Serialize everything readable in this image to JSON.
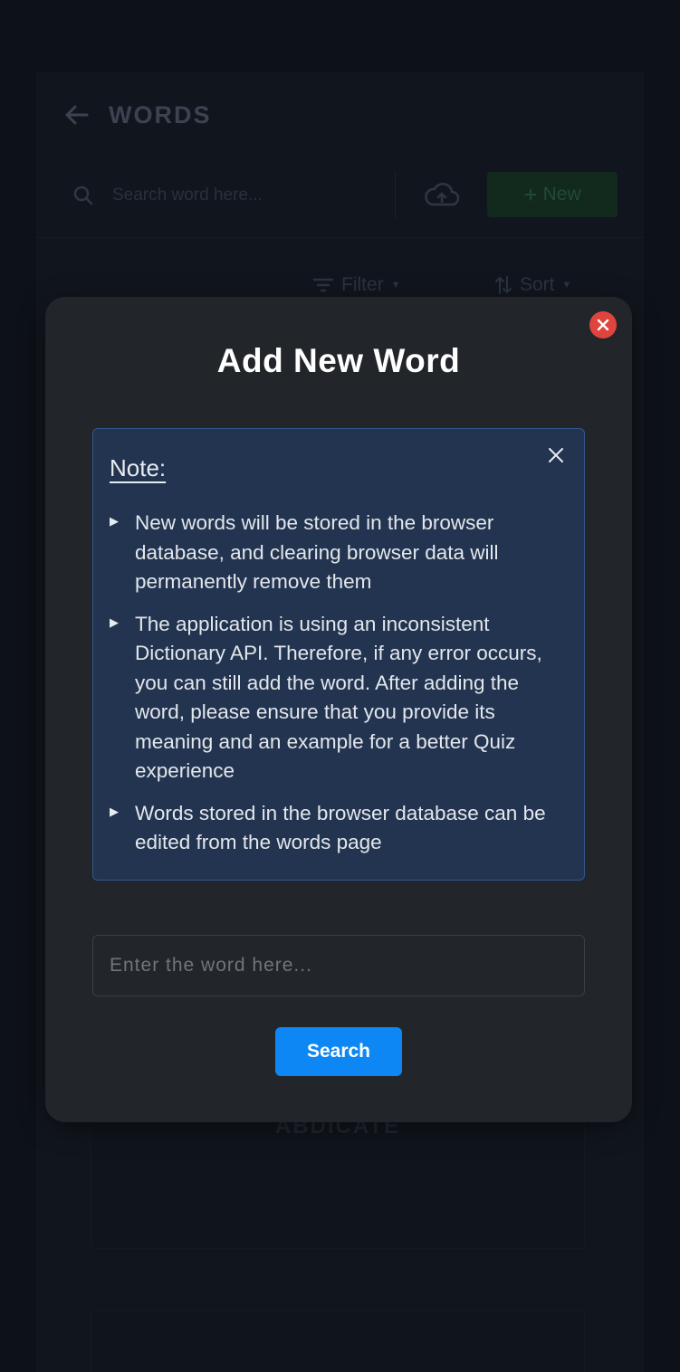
{
  "background": {
    "header_title": "WORDS",
    "search_placeholder": "Search word here...",
    "new_button_label": "New",
    "filter_label": "Filter",
    "sort_label": "Sort",
    "card_word": "ABDICATE"
  },
  "modal": {
    "title": "Add New Word",
    "note": {
      "heading": "Note:",
      "items": [
        "New words will be stored in the browser database, and clearing browser data will permanently remove them",
        "The application is using an inconsistent Dictionary API. Therefore, if any error occurs, you can still add the word. After adding the word, please ensure that you provide its meaning and an example for a better Quiz experience",
        "Words stored in the browser database can be edited from the words page"
      ]
    },
    "input_placeholder": "Enter the word here...",
    "input_value": "",
    "search_button_label": "Search"
  },
  "colors": {
    "page_background": "#0d1118",
    "modal_background": "#22262b",
    "note_background": "#233450",
    "note_border": "#35558a",
    "primary_button": "#0d87f4",
    "close_button": "#e0443e",
    "new_button_dimmed": "#12291d"
  },
  "icons": {
    "back": "arrow-left-icon",
    "search": "search-icon",
    "cloud": "cloud-upload-icon",
    "plus": "plus-icon",
    "filter": "filter-icon",
    "sort": "sort-icon",
    "modal_close": "close-circle-icon",
    "note_close": "close-icon",
    "bullet": "triangle-right-icon"
  }
}
